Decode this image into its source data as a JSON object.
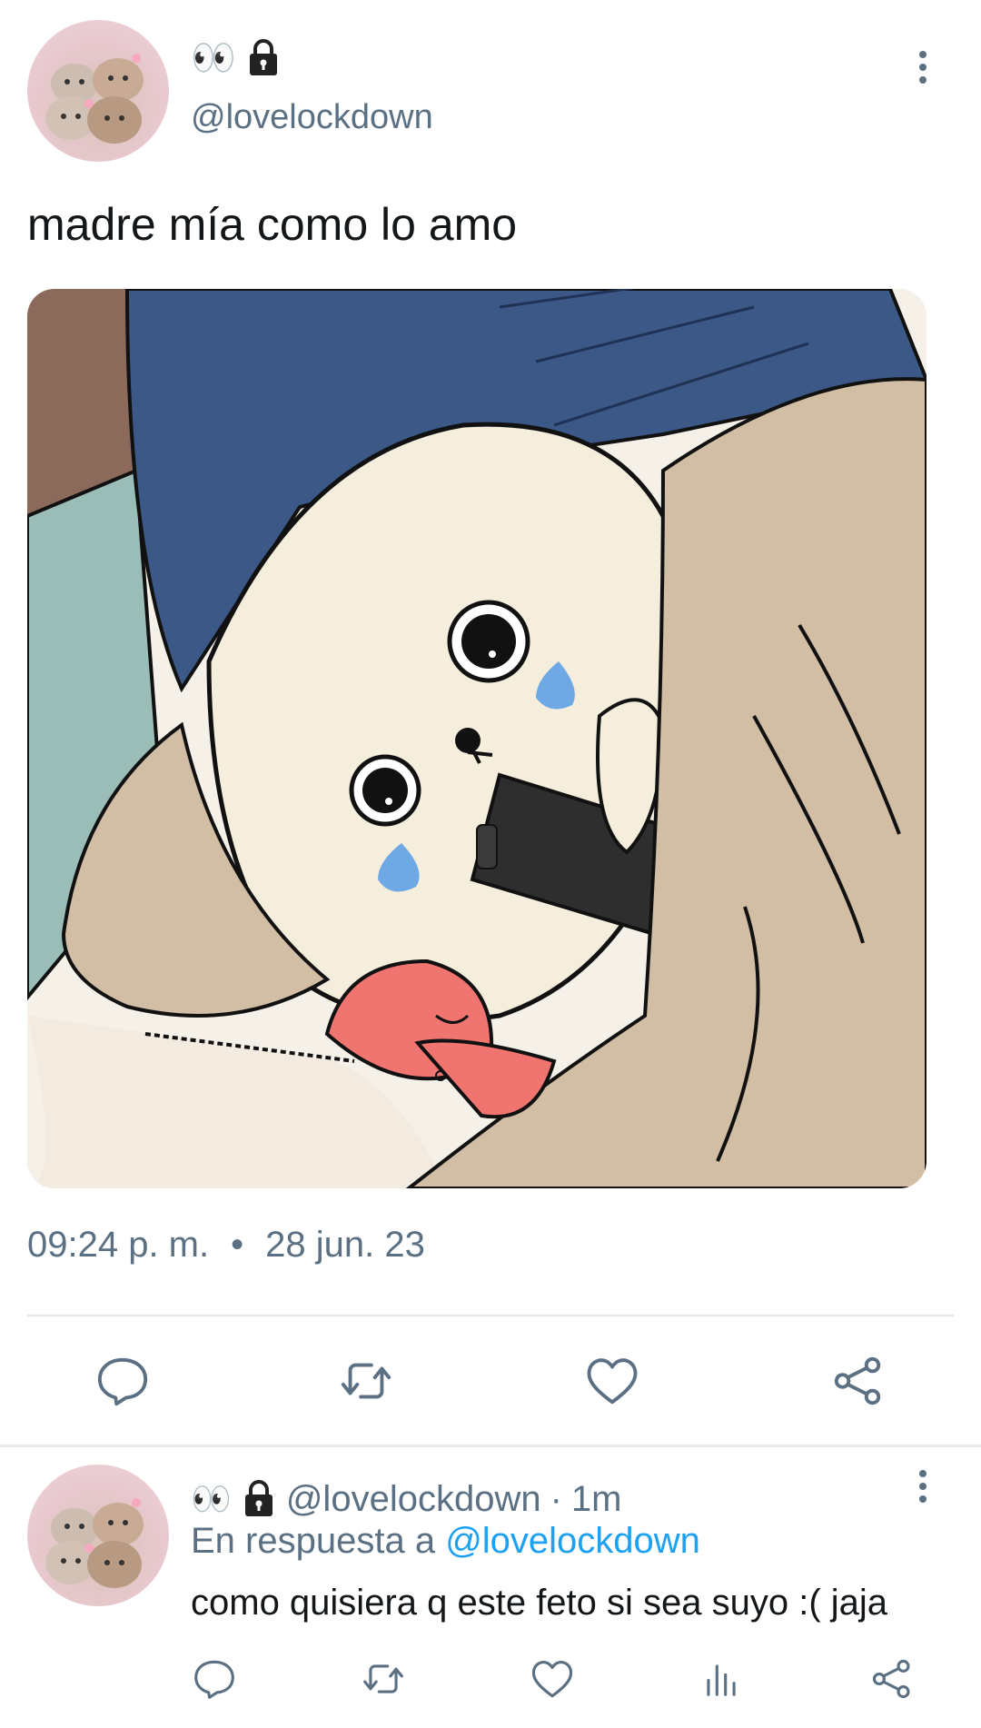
{
  "tweet": {
    "display_name_emoji": "👀",
    "handle": "@lovelockdown",
    "text": "madre mía como lo amo",
    "time": "09:24 p. m.",
    "separator_dot": "•",
    "date": "28 jun. 23",
    "icons": [
      "eyes-emoji",
      "lock-icon",
      "more-vert-icon",
      "reply-icon",
      "retweet-icon",
      "like-icon",
      "share-icon"
    ]
  },
  "reply": {
    "display_name_emoji": "👀",
    "handle": "@lovelockdown",
    "time_sep": "·",
    "time": "1m",
    "in_reply_prefix": "En respuesta a",
    "in_reply_mention": "@lovelockdown",
    "text": "como quisiera q este feto si sea suyo :( jaja",
    "icons": [
      "reply-icon",
      "retweet-icon",
      "like-icon",
      "analytics-icon",
      "share-icon"
    ]
  },
  "colors": {
    "secondary_text": "#5b7083",
    "mention": "#1da1f2",
    "divider": "#e1e8ed"
  }
}
